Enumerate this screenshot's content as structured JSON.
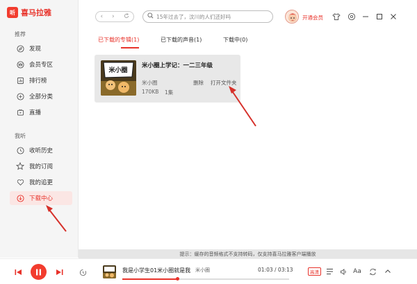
{
  "app": {
    "logo_mark": "听",
    "logo_text": "喜马拉雅"
  },
  "sidebar": {
    "section_recommend": "推荐",
    "section_mine": "我听",
    "items": [
      {
        "label": "发现",
        "icon": "compass-icon"
      },
      {
        "label": "会员专区",
        "icon": "crown-icon"
      },
      {
        "label": "排行榜",
        "icon": "ranking-icon"
      },
      {
        "label": "全部分类",
        "icon": "grid-icon"
      },
      {
        "label": "直播",
        "icon": "live-icon"
      },
      {
        "label": "收听历史",
        "icon": "clock-icon"
      },
      {
        "label": "我的订阅",
        "icon": "star-icon"
      },
      {
        "label": "我的追更",
        "icon": "heart-icon"
      },
      {
        "label": "下载中心",
        "icon": "download-icon",
        "active": true
      }
    ]
  },
  "topbar": {
    "search_placeholder": "15年过去了，汶川的人们还好吗",
    "vip_label": "开通会员"
  },
  "tabs": [
    {
      "label": "已下载的专辑(1)",
      "active": true
    },
    {
      "label": "已下载的声音(1)",
      "active": false
    },
    {
      "label": "下载中(0)",
      "active": false
    }
  ],
  "album": {
    "title": "米小圈上学记：一二三年级",
    "author": "米小圈",
    "delete_label": "删除",
    "open_label": "打开文件夹",
    "size": "170KB",
    "count": "1集",
    "cover_text": "米小圈"
  },
  "notice": "提示：缓存的音频格式不支持转码，仅支持喜马拉雅客户端播放",
  "player": {
    "track_title": "我是小学生01米小圈就是我",
    "author": "米小圈",
    "current_time": "01:03",
    "total_time": "03:13",
    "time_separator": " / ",
    "progress": 0.33,
    "quality_label": "高清",
    "font_label": "Aa"
  },
  "colors": {
    "accent": "#e8322a",
    "sidebar_bg": "#f5f5f5",
    "card_bg": "#e8e8e8"
  }
}
